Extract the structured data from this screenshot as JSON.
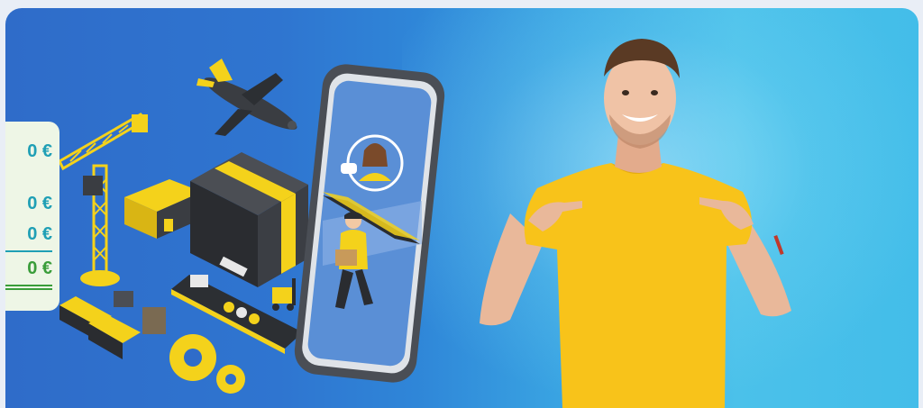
{
  "price_card": {
    "prices": [
      "0 €",
      "0 €",
      "0 €",
      "0 €"
    ]
  },
  "colors": {
    "brand_blue": "#2f6cc9",
    "accent_yellow": "#f4d21b",
    "shirt_yellow": "#f8c31a",
    "price_teal": "#1f9fb5",
    "price_green": "#3a9d3a"
  },
  "icons": [
    "airplane-icon",
    "crane-icon",
    "warehouse-icon",
    "box-icon",
    "smartphone-icon",
    "support-agent-icon",
    "courier-icon",
    "train-icon",
    "ship-icon",
    "truck-icon",
    "gears-icon",
    "forklift-icon"
  ]
}
